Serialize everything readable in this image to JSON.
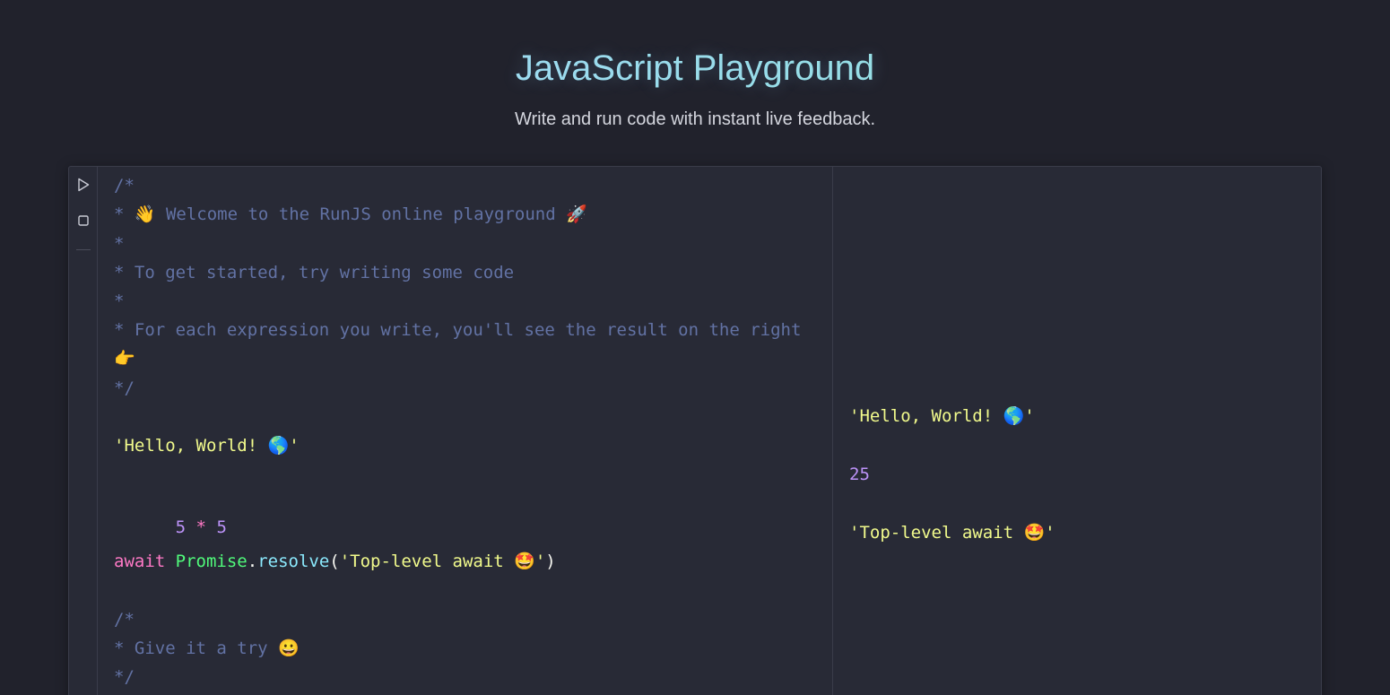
{
  "header": {
    "title": "JavaScript Playground",
    "subtitle": "Write and run code with instant live feedback."
  },
  "toolbar": {
    "run_icon": "play-icon",
    "stop_icon": "stop-icon"
  },
  "code": {
    "lines": [
      {
        "text": "/*"
      },
      {
        "text": "* 👋 Welcome to the RunJS online playground 🚀"
      },
      {
        "text": "*"
      },
      {
        "text": "* To get started, try writing some code"
      },
      {
        "text": "*"
      },
      {
        "text": "* For each expression you write, you'll see the result on the right"
      },
      {
        "text": "👉"
      },
      {
        "text": "*/"
      },
      {
        "text": "'Hello, World! 🌎'"
      },
      {
        "text_left": "5",
        "operator": "*",
        "text_right": "5"
      },
      {
        "keyword": "await",
        "class_name": "Promise",
        "dot": ".",
        "method": "resolve",
        "paren_open": "(",
        "arg": "'Top-level await 🤩'",
        "paren_close": ")"
      },
      {
        "text": "/*"
      },
      {
        "text": "* Give it a try 😀"
      },
      {
        "text": "*/"
      }
    ]
  },
  "results": {
    "items": [
      {
        "value": "'Hello, World! 🌎'"
      },
      {
        "value": "25"
      },
      {
        "value": "'Top-level await 🤩'"
      }
    ]
  },
  "colors": {
    "background": "#21222c",
    "editor_background": "#282a36",
    "comment": "#6272a4",
    "string": "#f1fa8c",
    "number": "#bd93f9",
    "keyword": "#ff79c6",
    "class": "#50fa7b",
    "function": "#8be9fd"
  }
}
